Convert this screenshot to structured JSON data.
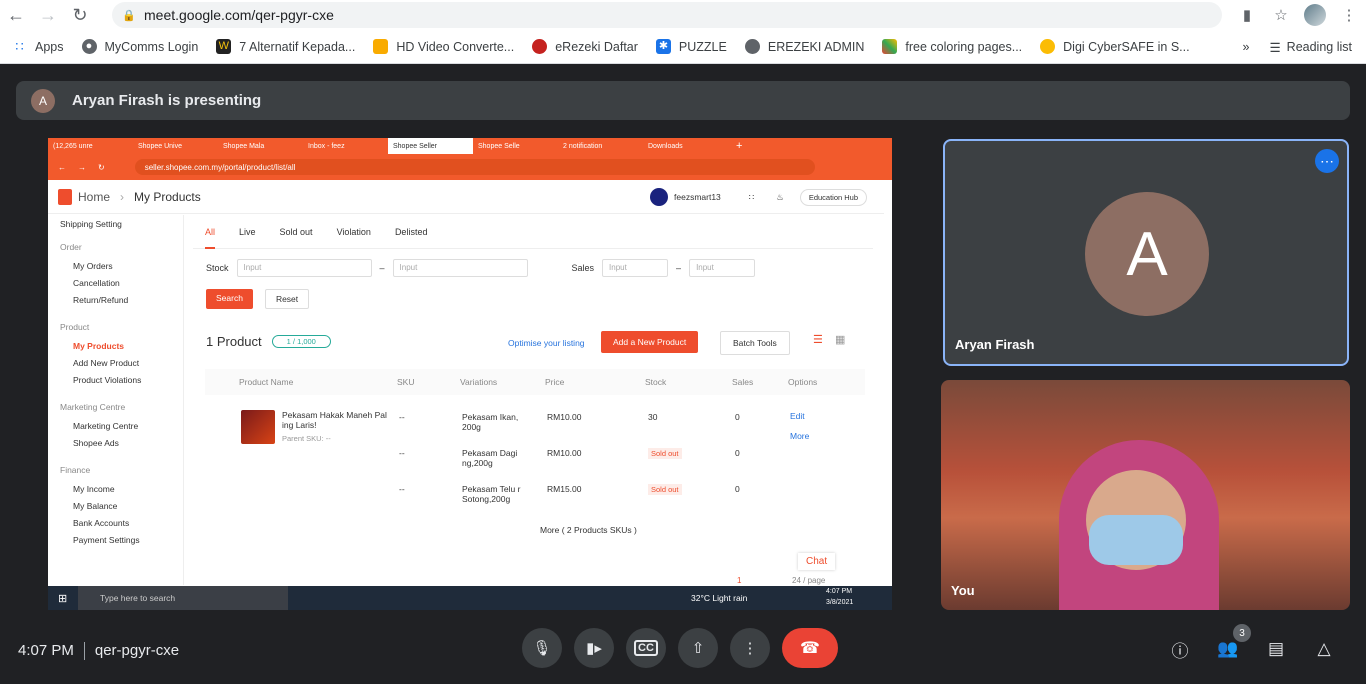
{
  "browser": {
    "url": "meet.google.com/qer-pgyr-cxe",
    "bookmarks": [
      "Apps",
      "MyComms Login",
      "7 Alternatif Kepada...",
      "HD Video Converte...",
      "eRezeki Daftar",
      "PUZZLE",
      "EREZEKI ADMIN",
      "free coloring pages...",
      "Digi CyberSAFE in S..."
    ],
    "reading_list": "Reading list"
  },
  "meeting": {
    "presenting_initial": "A",
    "presenting_text": "Aryan Firash is presenting",
    "time": "4:07 PM",
    "code": "qer-pgyr-cxe",
    "participants_count": "3",
    "tiles": [
      {
        "initial": "A",
        "name": "Aryan Firash"
      },
      {
        "name": "You"
      }
    ]
  },
  "shared_screen": {
    "tabs": [
      "(12,265 unre",
      "Shopee Unive",
      "Shopee Mala",
      "Inbox - feez",
      "Shopee Seller",
      "Shopee Selle",
      "2 notification",
      "Downloads"
    ],
    "url": "seller.shopee.com.my/portal/product/list/all",
    "breadcrumb_home": "Home",
    "breadcrumb_page": "My Products",
    "username": "feezsmart13",
    "education_hub": "Education Hub",
    "sidebar": [
      {
        "header": "",
        "items": [
          "Shipping Setting"
        ]
      },
      {
        "header": "Order",
        "items": [
          "My Orders",
          "Cancellation",
          "Return/Refund"
        ]
      },
      {
        "header": "Product",
        "items": [
          "My Products",
          "Add New Product",
          "Product Violations"
        ]
      },
      {
        "header": "Marketing Centre",
        "items": [
          "Marketing Centre",
          "Shopee Ads"
        ]
      },
      {
        "header": "Finance",
        "items": [
          "My Income",
          "My Balance",
          "Bank Accounts",
          "Payment Settings"
        ]
      }
    ],
    "filter_tabs": [
      "All",
      "Live",
      "Sold out",
      "Violation",
      "Delisted"
    ],
    "stock_label": "Stock",
    "sales_label": "Sales",
    "input_placeholder": "Input",
    "search": "Search",
    "reset": "Reset",
    "product_count": "1 Product",
    "quota": "1 / 1,000",
    "optimise": "Optimise your listing",
    "add_new": "Add a New Product",
    "batch_tools": "Batch Tools",
    "columns": [
      "Product Name",
      "SKU",
      "Variations",
      "Price",
      "Stock",
      "Sales",
      "Options"
    ],
    "product_name": "Pekasam Hakak Maneh Pal ing Laris!",
    "parent_sku": "Parent SKU: --",
    "rows": [
      {
        "sku": "--",
        "variation": "Pekasam Ikan, 200g",
        "price": "RM10.00",
        "stock": "30",
        "sales": "0"
      },
      {
        "sku": "--",
        "variation": "Pekasam Dagi ng,200g",
        "price": "RM10.00",
        "stock": "Sold out",
        "sales": "0"
      },
      {
        "sku": "--",
        "variation": "Pekasam Telu r Sotong,200g",
        "price": "RM15.00",
        "stock": "Sold out",
        "sales": "0"
      }
    ],
    "edit": "Edit",
    "more": "More",
    "more_skus": "More ( 2 Products SKUs )",
    "chat": "Chat",
    "page": "1",
    "per_page": "24 / page",
    "taskbar_search": "Type here to search",
    "weather": "32°C  Light rain",
    "clock_time": "4:07 PM",
    "clock_date": "3/8/2021"
  }
}
